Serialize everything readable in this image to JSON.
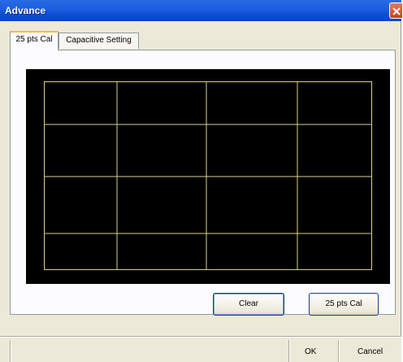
{
  "window": {
    "title": "Advance"
  },
  "tabs": [
    {
      "label": "25 pts Cal",
      "active": true
    },
    {
      "label": "Capacitive Setting",
      "active": false
    }
  ],
  "canvas": {
    "background": "#000000",
    "grid_color": "#d8d28a"
  },
  "buttons": {
    "clear": "Clear",
    "cal25": "25 pts Cal"
  },
  "statusbar": {
    "ok": "OK",
    "cancel": "Cancel"
  }
}
